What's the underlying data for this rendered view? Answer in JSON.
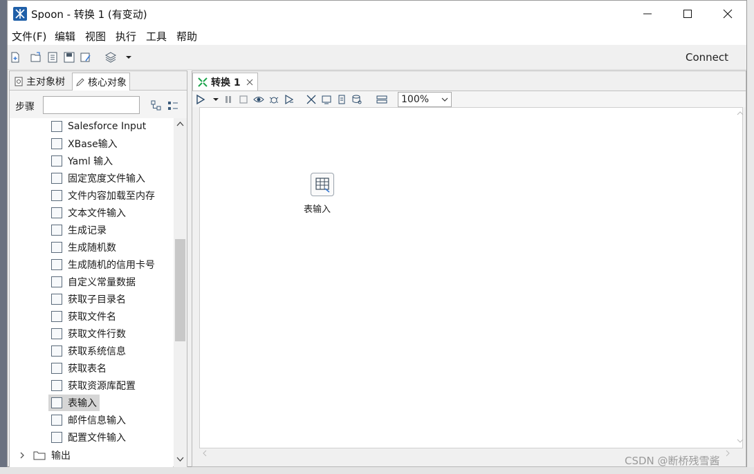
{
  "window": {
    "title": "Spoon - 转换 1 (有变动)"
  },
  "menu": [
    "文件(F)",
    "编辑",
    "视图",
    "执行",
    "工具",
    "帮助"
  ],
  "toolbar": {
    "connect_label": "Connect"
  },
  "left_panel": {
    "tabs": [
      "主对象树",
      "核心对象"
    ],
    "search_label": "步骤",
    "search_value": "",
    "items": [
      "Salesforce Input",
      "XBase输入",
      "Yaml 输入",
      "固定宽度文件输入",
      "文件内容加载至内存",
      "文本文件输入",
      "生成记录",
      "生成随机数",
      "生成随机的信用卡号",
      "自定义常量数据",
      "获取子目录名",
      "获取文件名",
      "获取文件行数",
      "获取系统信息",
      "获取表名",
      "获取资源库配置",
      "表输入",
      "邮件信息输入",
      "配置文件输入"
    ],
    "selected_item": "表输入",
    "folder_label": "输出"
  },
  "canvas_panel": {
    "tab_label": "转换 1",
    "zoom_value": "100%",
    "step_label": "表输入"
  },
  "watermark": "CSDN @断桥残雪酱"
}
